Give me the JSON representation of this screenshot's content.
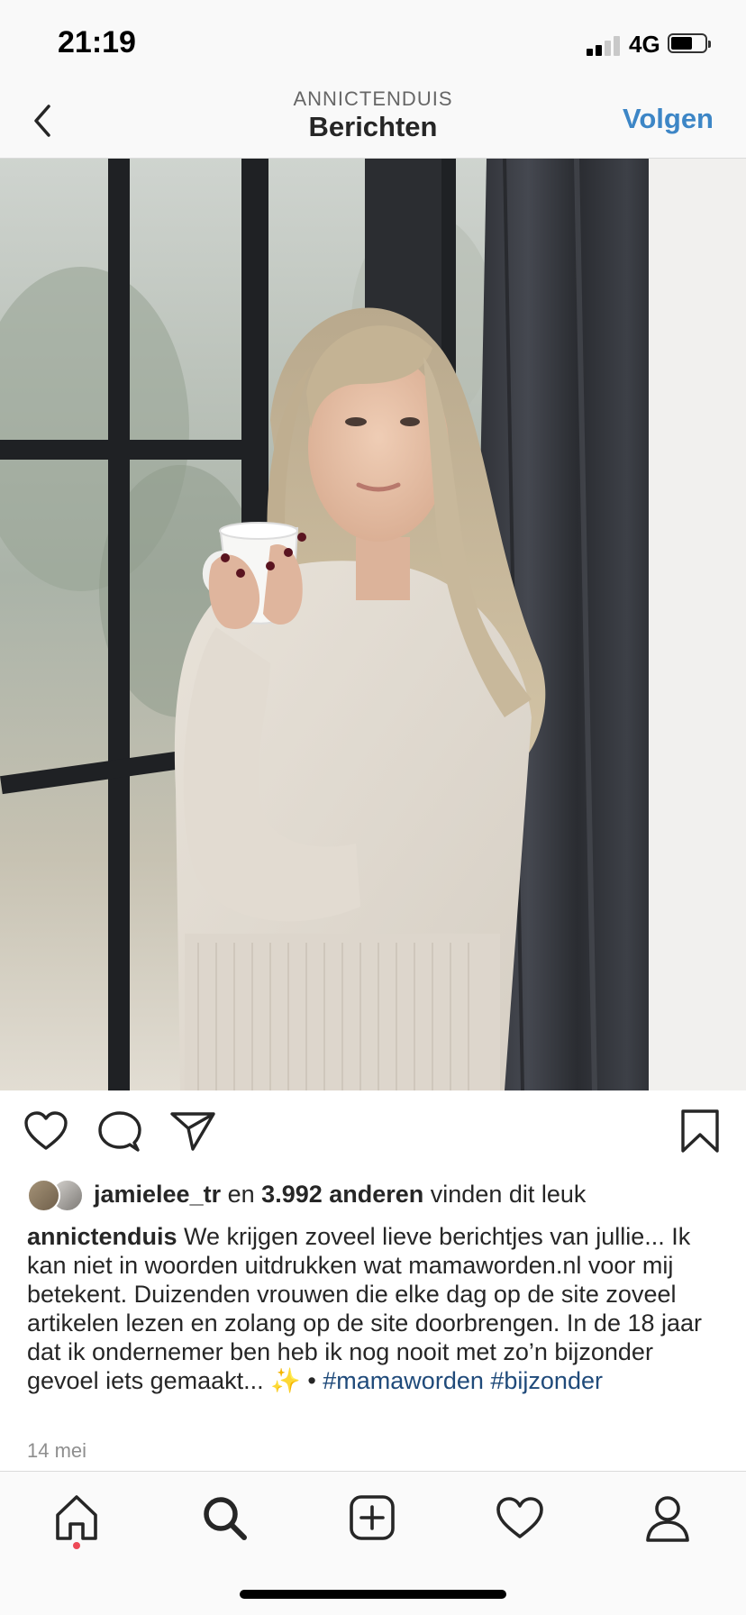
{
  "status_bar": {
    "time": "21:19",
    "network": "4G",
    "signal_bars": 2,
    "signal_bars_total": 4,
    "battery_level": 0.55
  },
  "header": {
    "username": "ANNICTENDUIS",
    "title": "Berichten",
    "follow_label": "Volgen"
  },
  "post": {
    "likes": {
      "user": "jamielee_tr",
      "connector": "en",
      "count_text": "3.992 anderen",
      "suffix": "vinden dit leuk"
    },
    "caption": {
      "author": "annictenduis",
      "text": "We krijgen zoveel lieve berichtjes van jullie... Ik kan niet in woorden uitdrukken wat mamaworden.nl voor mij betekent. Duizenden vrouwen die elke dag op de site zoveel artikelen lezen en zolang op de site doorbrengen. In de 18 jaar dat ik ondernemer ben heb ik nog nooit met zo’n bijzonder gevoel iets gemaakt...",
      "emoji": "✨",
      "separator": "•",
      "hashtags": [
        "#mamaworden",
        "#bijzonder"
      ]
    },
    "date": "14 mei"
  },
  "icons": {
    "back": "chevron-left-icon",
    "like": "heart-outline-icon",
    "comment": "speech-bubble-icon",
    "share": "paper-plane-icon",
    "save": "bookmark-icon",
    "tabs": [
      "home-icon",
      "search-icon",
      "add-post-icon",
      "activity-heart-icon",
      "profile-icon"
    ]
  },
  "colors": {
    "follow_blue": "#3d86c6",
    "hashtag": "#1f4a7a",
    "notification_dot": "#ed4956"
  }
}
